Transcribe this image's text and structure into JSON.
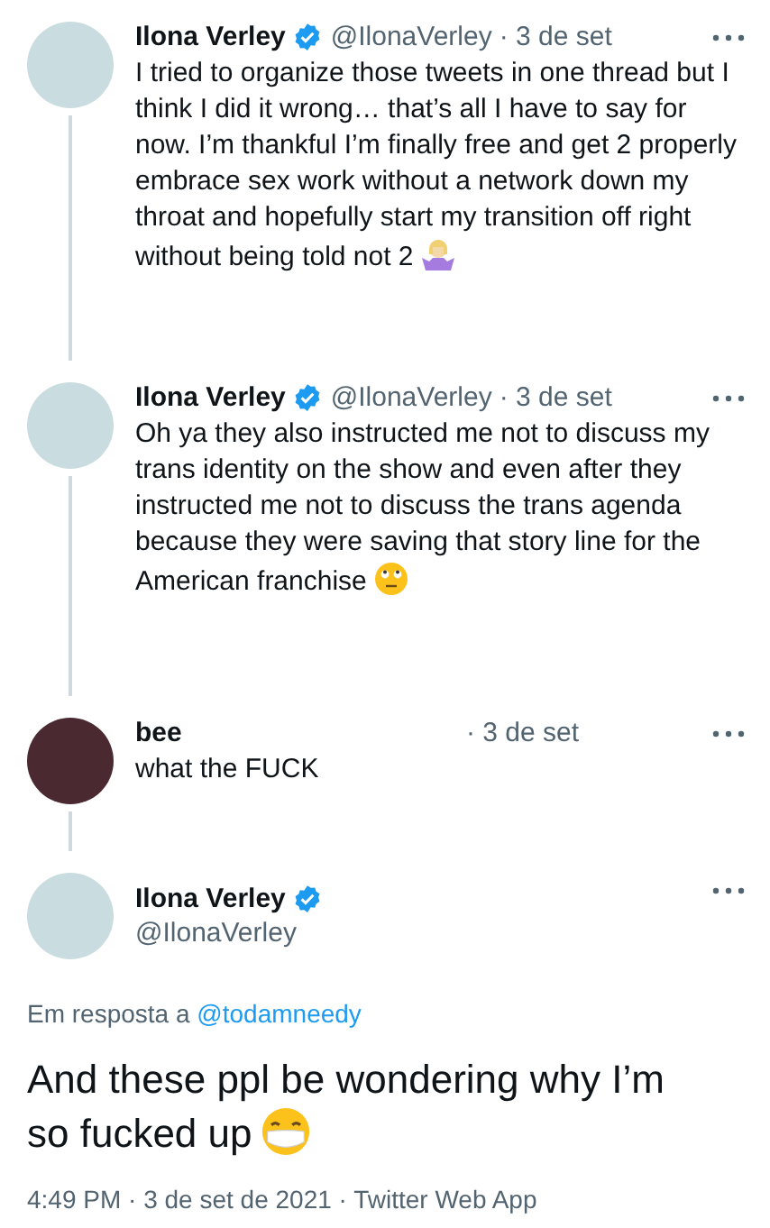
{
  "thread": [
    {
      "kind": "shrug",
      "name": "Ilona Verley",
      "verified": true,
      "handle": "@IlonaVerley",
      "date": "· 3 de set",
      "text": "I tried to organize those tweets in one thread but I think I did it wrong… that’s all I have to say for now. I’m thankful I’m finally free and get 2 properly embrace sex work without a network down my throat and hopefully start my transition off right without being told not 2",
      "color": "#c9dcdf"
    },
    {
      "kind": "eyeroll",
      "name": "Ilona Verley",
      "verified": true,
      "handle": "@IlonaVerley",
      "date": "· 3 de set",
      "text": "Oh ya they also instructed me not to discuss my trans identity on the show and even after they instructed me not to discuss the trans agenda because they were saving that story line for the American franchise",
      "color": "#c9dcdf"
    },
    {
      "kind": "plain",
      "name": "bee",
      "verified": false,
      "date": "· 3 de set",
      "text": "what the FUCK",
      "color": "#4a2a30"
    }
  ],
  "main": {
    "kind": "mask",
    "name": "Ilona Verley",
    "verified": true,
    "handle": "@IlonaVerley",
    "reply_label": "Em resposta a",
    "reply_to": "@todamneedy",
    "text": "And these ppl be wondering why I’m so fucked up",
    "color": "#c9dcdf",
    "footer": "4:49 PM · 3 de set de 2021 · Twitter Web App"
  }
}
